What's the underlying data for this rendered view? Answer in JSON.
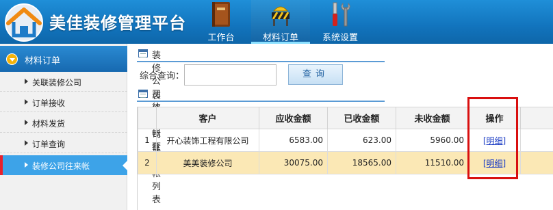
{
  "app": {
    "title": "美佳装修管理平台"
  },
  "nav": [
    {
      "label": "工作台",
      "icon": "book-icon",
      "active": false
    },
    {
      "label": "材料订单",
      "icon": "construction-barrier-icon",
      "active": true
    },
    {
      "label": "系统设置",
      "icon": "tools-icon",
      "active": false
    }
  ],
  "sidebar": {
    "section": "材料订单",
    "items": [
      {
        "label": "关联装修公司"
      },
      {
        "label": "订单接收"
      },
      {
        "label": "材料发货"
      },
      {
        "label": "订单查询"
      },
      {
        "label": "装修公司往来帐",
        "active": true
      }
    ]
  },
  "query_section": {
    "title": "装修公司往来帐查询",
    "label": "综合查询：",
    "value": "",
    "button": "查询"
  },
  "list_section": {
    "title": "装修公司往来帐列表"
  },
  "table": {
    "headers": [
      "客户",
      "应收金额",
      "已收金额",
      "未收金额",
      "操作"
    ],
    "rows": [
      {
        "index": "1",
        "customer": "开心装饰工程有限公司",
        "receivable": "6583.00",
        "received": "623.00",
        "outstanding": "5960.00",
        "action": "[明细]"
      },
      {
        "index": "2",
        "customer": "美美装修公司",
        "receivable": "30075.00",
        "received": "18565.00",
        "outstanding": "11510.00",
        "action": "[明细]"
      }
    ]
  },
  "colors": {
    "header_blue": "#1274bd",
    "sidebar_active": "#3da3e8",
    "row_highlight": "#fbe8b5",
    "annotation_red": "#d90f0f"
  }
}
